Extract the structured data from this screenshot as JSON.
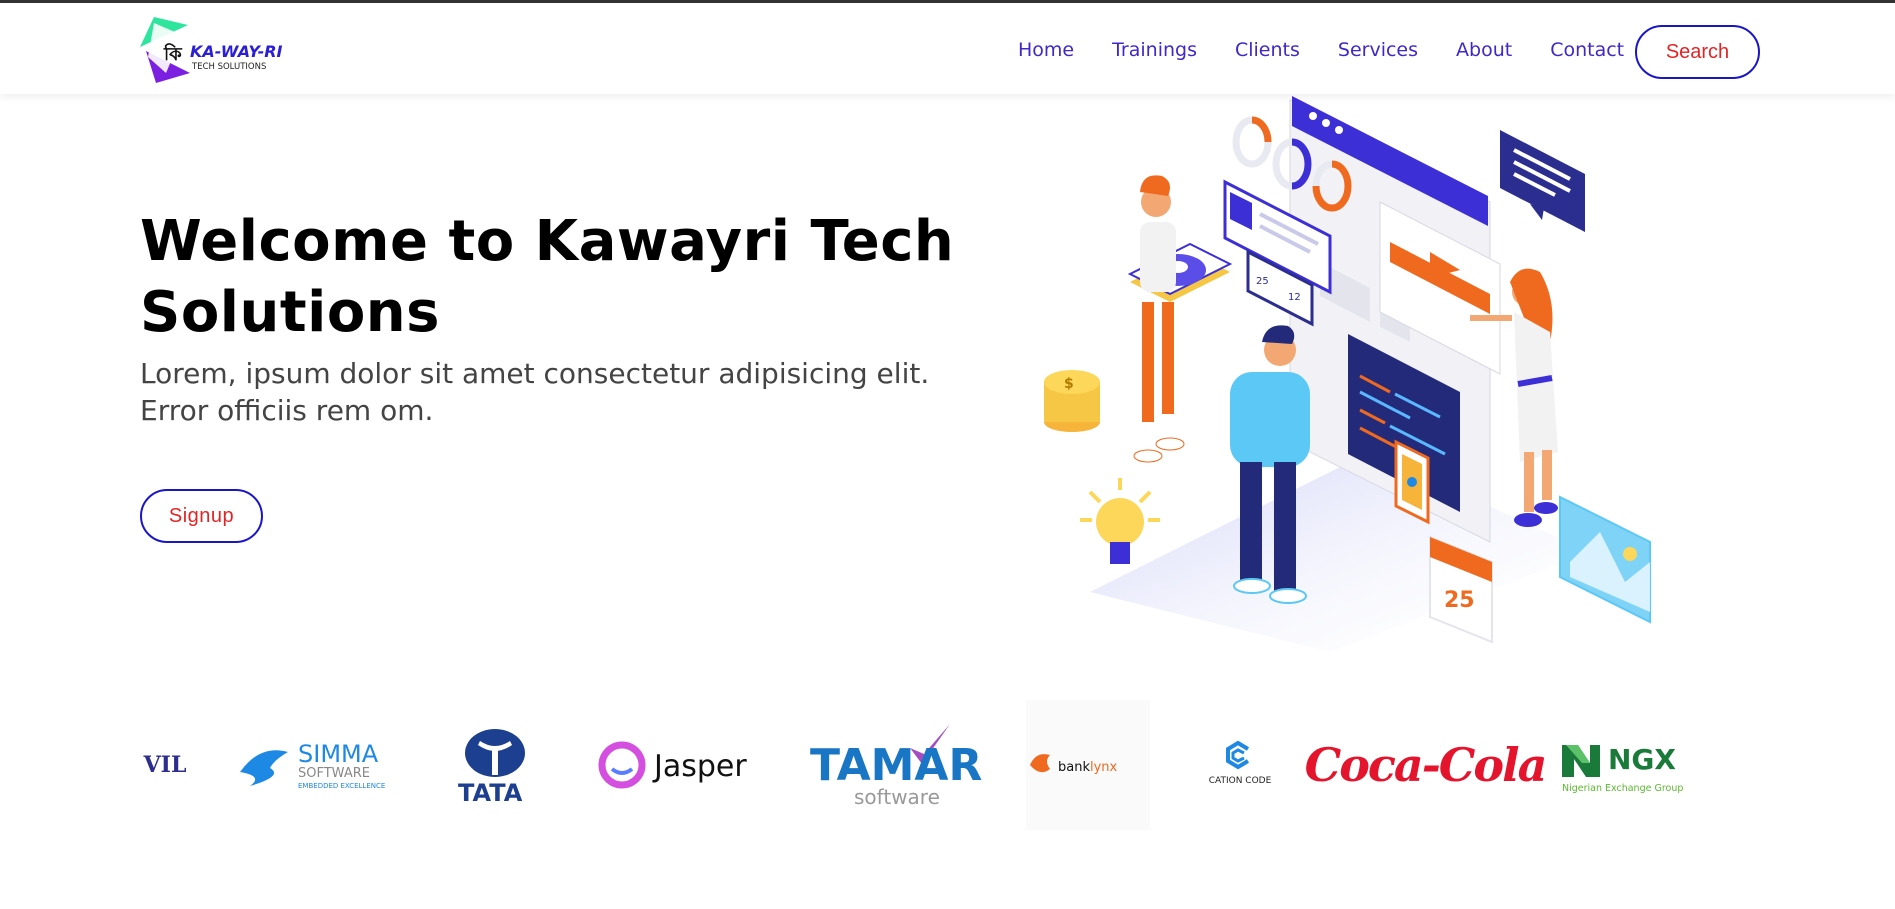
{
  "brand": {
    "logo_main": "KA-WAY-RI",
    "logo_sub": "TECH SOLUTIONS",
    "logo_glyph": "কি",
    "colors": {
      "primary": "#3f28c9",
      "border": "#1a15c6",
      "accent": "#e32424",
      "logo_green": "#2ee59d",
      "logo_purple": "#7b1fe0"
    }
  },
  "nav": {
    "items": [
      "Home",
      "Trainings",
      "Clients",
      "Services",
      "About",
      "Contact"
    ],
    "search_label": "Search"
  },
  "hero": {
    "title": "Welcome to Kawayri Tech Solutions",
    "subtitle": "Lorem, ipsum dolor sit amet consectetur adipisicing elit. Error officiis rem om.",
    "signup_label": "Signup",
    "illustration_texts": {
      "likes": "25",
      "comments": "12",
      "calendar_day": "25",
      "coin_symbol": "$"
    }
  },
  "clients": {
    "partial_logo_text": "VIL",
    "simma": {
      "name": "SIMMA",
      "line2": "SOFTWARE",
      "line3": "EMBEDDED EXCELLENCE"
    },
    "tata": "TATA",
    "jasper": "Jasper",
    "tamar": {
      "name": "TAMAR",
      "line2": "software"
    },
    "banklynx": {
      "part1": "bank",
      "part2": "lynx"
    },
    "cationcode": "CATION CODE",
    "cocacola": "Coca-Cola",
    "ngx": {
      "name": "NGX",
      "line2": "Nigerian Exchange Group"
    }
  }
}
